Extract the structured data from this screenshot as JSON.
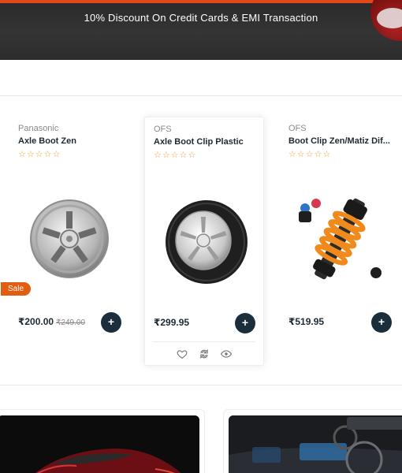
{
  "promo": {
    "text": "10% Discount On Credit Cards & EMI Transaction",
    "accent_color": "#e2481a"
  },
  "products": [
    {
      "brand": "Panasonic",
      "title": "Axle Boot Zen",
      "stars": "☆☆☆☆☆",
      "image": "alloy-wheel",
      "badge": "Sale",
      "price": "₹200.00",
      "old_price": "₹249.00",
      "add_label": "+"
    },
    {
      "brand": "OFS",
      "title": "Axle Boot Clip Plastic",
      "stars": "☆☆☆☆☆",
      "image": "tire-wheel",
      "price": "₹299.95",
      "add_label": "+",
      "actions": [
        "heart-icon",
        "compare-icon",
        "eye-icon"
      ]
    },
    {
      "brand": "OFS",
      "title": "Boot Clip Zen/Matiz Dif...",
      "stars": "☆☆☆☆☆",
      "image": "shock-absorber",
      "price": "₹519.95",
      "add_label": "+"
    }
  ],
  "colors": {
    "sale_badge": "#e35d10",
    "add_button": "#1b2e3c",
    "star": "#f0a030"
  }
}
